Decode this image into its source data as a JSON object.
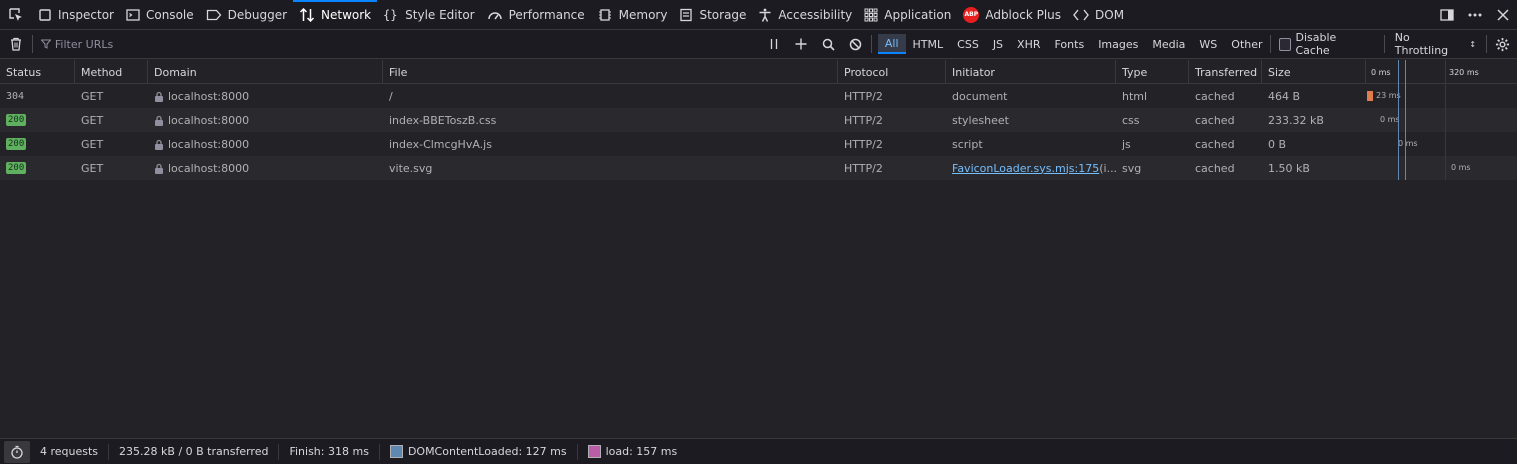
{
  "toolbox": {
    "tabs": [
      {
        "label": "Inspector",
        "icon": "inspector-icon"
      },
      {
        "label": "Console",
        "icon": "console-icon"
      },
      {
        "label": "Debugger",
        "icon": "debugger-icon"
      },
      {
        "label": "Network",
        "icon": "network-icon",
        "selected": true
      },
      {
        "label": "Style Editor",
        "icon": "style-editor-icon"
      },
      {
        "label": "Performance",
        "icon": "performance-icon"
      },
      {
        "label": "Memory",
        "icon": "memory-icon"
      },
      {
        "label": "Storage",
        "icon": "storage-icon"
      },
      {
        "label": "Accessibility",
        "icon": "accessibility-icon"
      },
      {
        "label": "Application",
        "icon": "application-icon"
      },
      {
        "label": "Adblock Plus",
        "icon": "adblock-plus-icon",
        "badge": "ABP"
      },
      {
        "label": "DOM",
        "icon": "dom-icon"
      }
    ]
  },
  "netToolbar": {
    "filter_placeholder": "Filter URLs",
    "types": [
      "All",
      "HTML",
      "CSS",
      "JS",
      "XHR",
      "Fonts",
      "Images",
      "Media",
      "WS",
      "Other"
    ],
    "active_type": "All",
    "disable_cache_label": "Disable Cache",
    "throttling_label": "No Throttling"
  },
  "table": {
    "columns": [
      "Status",
      "Method",
      "Domain",
      "File",
      "Protocol",
      "Initiator",
      "Type",
      "Transferred",
      "Size"
    ],
    "waterfall_ticks": [
      "0 ms",
      "320 ms"
    ],
    "rows": [
      {
        "status": "304",
        "status_badge": false,
        "method": "GET",
        "domain": "localhost:8000",
        "file": "/",
        "protocol": "HTTP/2",
        "initiator": "document",
        "initiator_link": false,
        "type": "html",
        "transferred": "cached",
        "size": "464 B",
        "timing": "23 ms"
      },
      {
        "status": "200",
        "status_badge": true,
        "method": "GET",
        "domain": "localhost:8000",
        "file": "index-BBEToszB.css",
        "protocol": "HTTP/2",
        "initiator": "stylesheet",
        "initiator_link": false,
        "type": "css",
        "transferred": "cached",
        "size": "233.32 kB",
        "timing": "0 ms"
      },
      {
        "status": "200",
        "status_badge": true,
        "method": "GET",
        "domain": "localhost:8000",
        "file": "index-ClmcgHvA.js",
        "protocol": "HTTP/2",
        "initiator": "script",
        "initiator_link": false,
        "type": "js",
        "transferred": "cached",
        "size": "0 B",
        "timing": "0 ms"
      },
      {
        "status": "200",
        "status_badge": true,
        "method": "GET",
        "domain": "localhost:8000",
        "file": "vite.svg",
        "protocol": "HTTP/2",
        "initiator": "FaviconLoader.sys.mjs:175",
        "initiator_suffix": " (i...",
        "initiator_link": true,
        "type": "svg",
        "transferred": "cached",
        "size": "1.50 kB",
        "timing": "0 ms"
      }
    ]
  },
  "statusbar": {
    "requests": "4 requests",
    "transferred": "235.28 kB / 0 B transferred",
    "finish": "Finish: 318 ms",
    "dom_content_loaded": "DOMContentLoaded: 127 ms",
    "load": "load: 157 ms",
    "dcl_color": "#5e88b0",
    "load_color": "#b95da6"
  }
}
